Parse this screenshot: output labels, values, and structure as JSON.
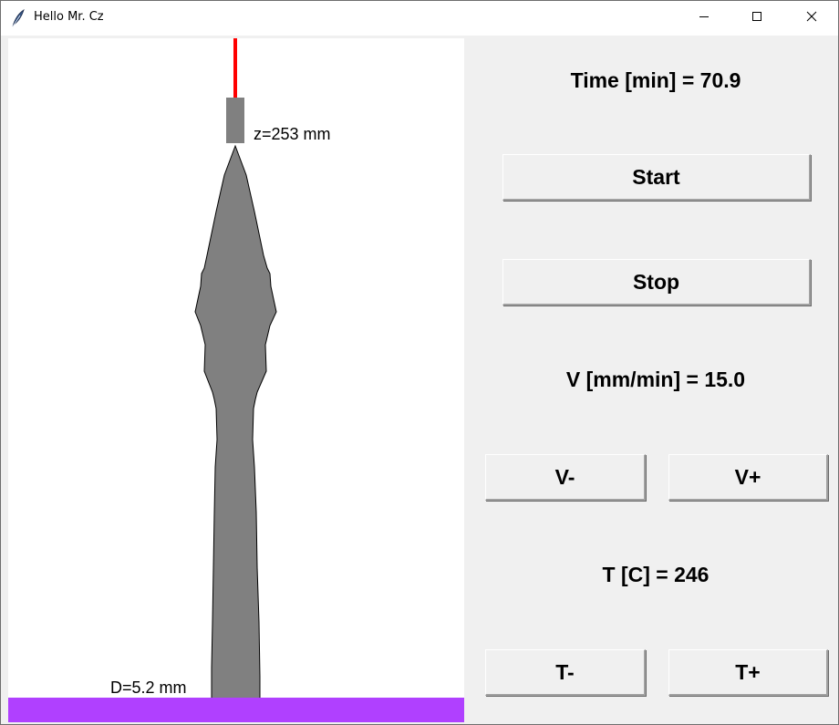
{
  "window": {
    "title": "Hello Mr. Cz",
    "icon": "feather-icon",
    "controls": [
      "minimize-icon",
      "maximize-icon",
      "close-icon"
    ]
  },
  "canvas": {
    "z_label": "z=253 mm",
    "d_label": "D=5.2 mm",
    "colors": {
      "fiber": "#808080",
      "nozzle": "#808080",
      "rod": "#ff0000",
      "base": "#b040ff",
      "background": "#ffffff"
    }
  },
  "controls": {
    "time_label": "Time [min] = 70.9",
    "start_label": "Start",
    "stop_label": "Stop",
    "v_label": "V [mm/min] = 15.0",
    "v_minus_label": "V-",
    "v_plus_label": "V+",
    "t_label": "T [C] = 246",
    "t_minus_label": "T-",
    "t_plus_label": "T+"
  }
}
